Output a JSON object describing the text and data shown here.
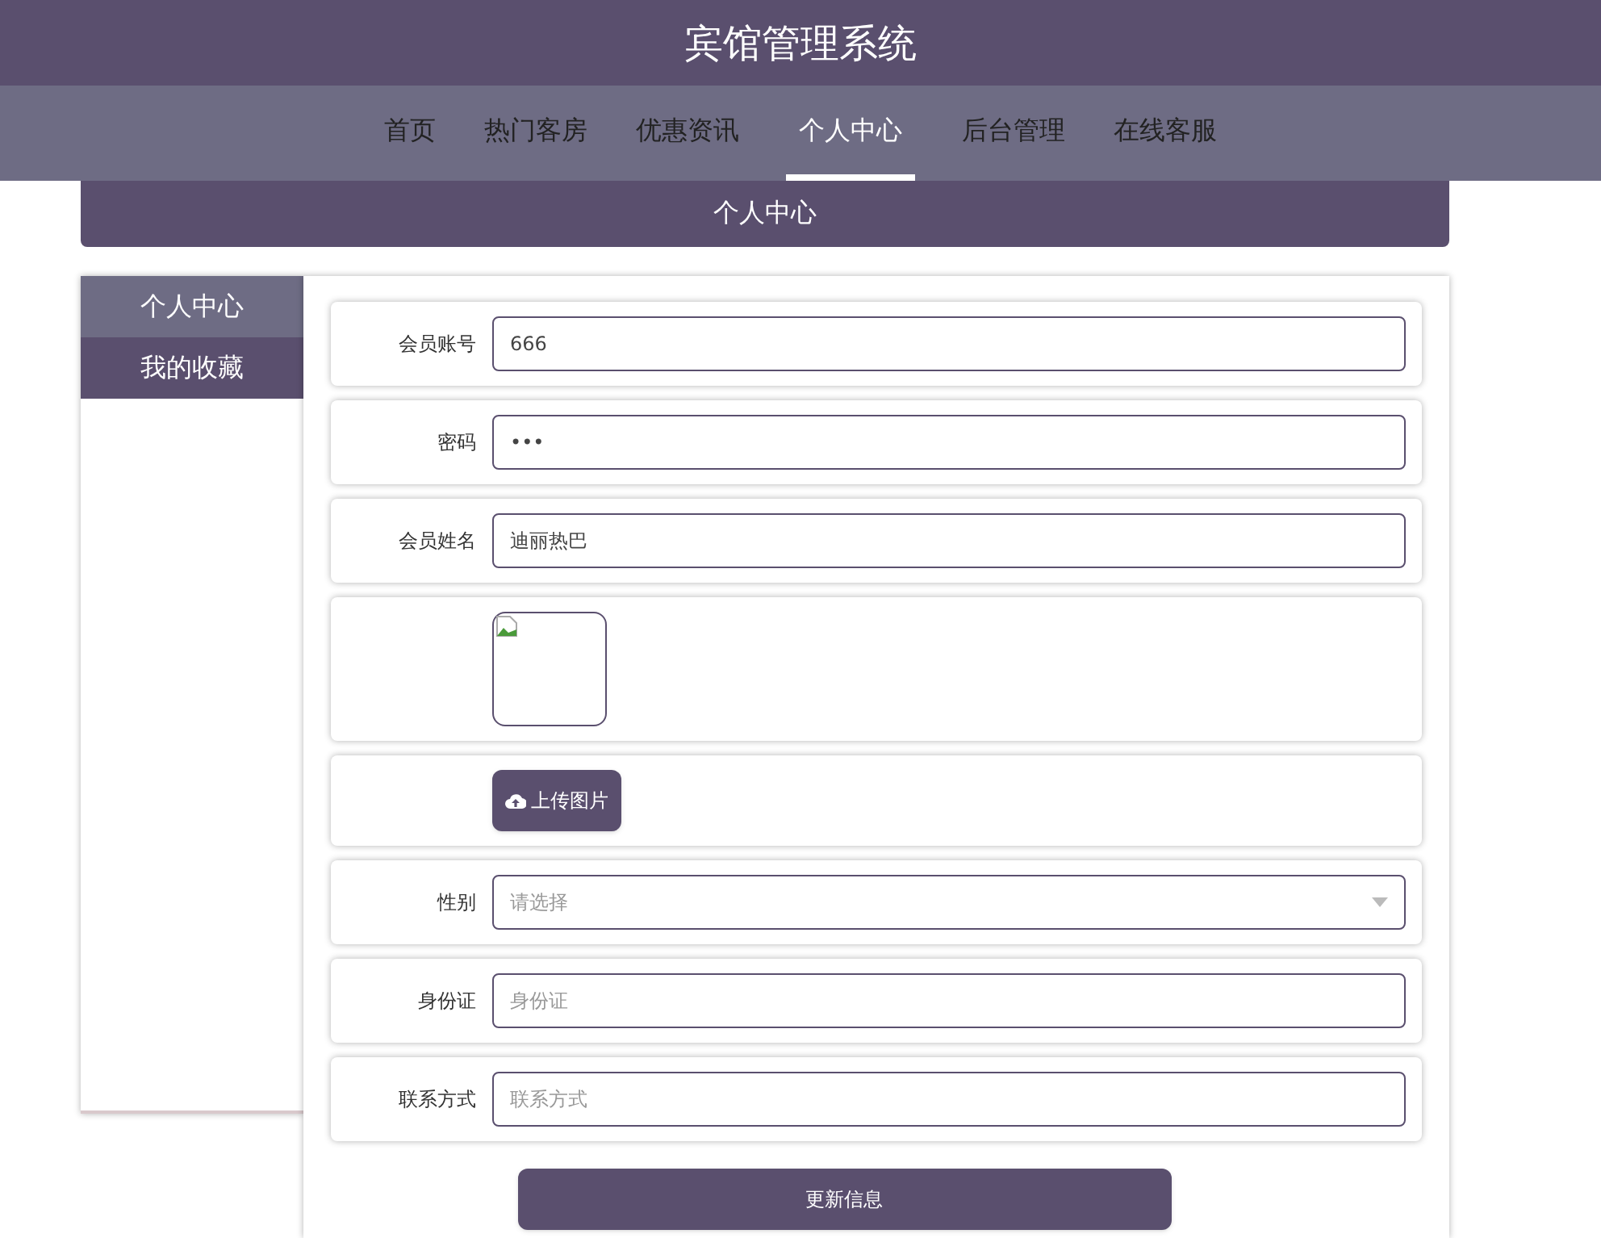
{
  "header": {
    "title": "宾馆管理系统"
  },
  "nav": [
    {
      "label": "首页",
      "selected": false
    },
    {
      "label": "热门客房",
      "selected": false
    },
    {
      "label": "优惠资讯",
      "selected": false
    },
    {
      "label": "个人中心",
      "selected": true
    },
    {
      "label": "后台管理",
      "selected": false
    },
    {
      "label": "在线客服",
      "selected": false
    }
  ],
  "banner": {
    "title": "个人中心"
  },
  "sidebar": {
    "items": [
      {
        "label": "个人中心",
        "selected": true
      },
      {
        "label": "我的收藏",
        "selected": false
      }
    ]
  },
  "form": {
    "fields": [
      {
        "kind": "text",
        "label": "会员账号",
        "value": "666"
      },
      {
        "kind": "password",
        "label": "密码",
        "value": "•••"
      },
      {
        "kind": "text",
        "label": "会员姓名",
        "value": "迪丽热巴"
      },
      {
        "kind": "image"
      },
      {
        "kind": "upload",
        "button": "上传图片"
      },
      {
        "kind": "select",
        "label": "性别",
        "placeholder": "请选择"
      },
      {
        "kind": "text",
        "label": "身份证",
        "placeholder": "身份证"
      },
      {
        "kind": "text",
        "label": "联系方式",
        "placeholder": "联系方式"
      }
    ],
    "submit": "更新信息"
  }
}
